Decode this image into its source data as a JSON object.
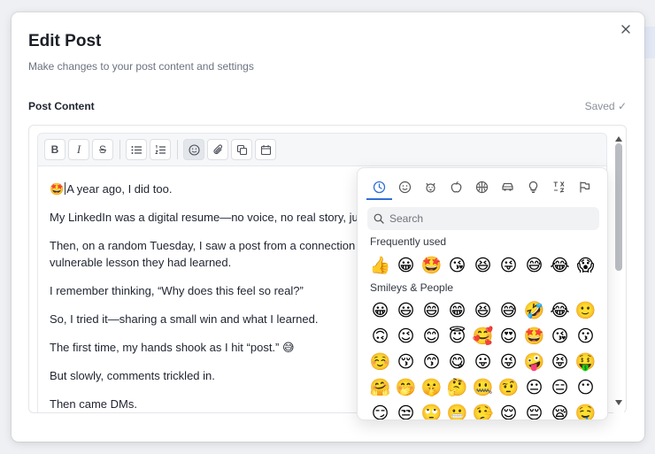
{
  "modal": {
    "title": "Edit Post",
    "subtitle": "Make changes to your post content and settings",
    "section_label": "Post Content",
    "saved_status": "Saved ✓",
    "close_icon": "close-icon"
  },
  "toolbar": {
    "bold": "B",
    "italic": "I",
    "strike": "S",
    "icons": [
      "bulleted-list-icon",
      "numbered-list-icon",
      "emoji-icon",
      "attach-icon",
      "copy-icon",
      "calendar-icon"
    ]
  },
  "editor": {
    "p1_emoji": "🤩",
    "p1_text": "A year ago, I did too.",
    "p2": "My LinkedIn was a digital resume—no voice, no real story, just",
    "p3a": "Then, on a random Tuesday, I saw a post from a connection wh",
    "p3b": "vulnerable lesson they had learned.",
    "p4": "I remember thinking, “Why does this feel so real?”",
    "p5": "So, I tried it—sharing a small win and what I learned.",
    "p6_text": "The first time, my hands shook as I hit “post.”",
    "p6_emoji": "😅",
    "p7": "But slowly, comments trickled in.",
    "p8": "Then came DMs."
  },
  "emoji_picker": {
    "categories": [
      "recent-icon",
      "smiley-icon",
      "animal-icon",
      "food-icon",
      "activity-icon",
      "travel-icon",
      "objects-icon",
      "symbols-icon",
      "flags-icon"
    ],
    "active_category": 0,
    "search_placeholder": "Search",
    "frequently_used_label": "Frequently used",
    "frequently_used": [
      "👍",
      "😀",
      "🤩",
      "😘",
      "😆",
      "😜",
      "😅",
      "😂",
      "😱"
    ],
    "smileys_label": "Smileys & People",
    "smileys_rows": [
      [
        "😀",
        "😃",
        "😄",
        "😁",
        "😆",
        "😅",
        "🤣",
        "😂",
        "🙂"
      ],
      [
        "🙃",
        "😉",
        "😊",
        "😇",
        "🥰",
        "😍",
        "🤩",
        "😘",
        "😗"
      ],
      [
        "☺️",
        "😚",
        "😙",
        "😋",
        "😛",
        "😜",
        "🤪",
        "😝",
        "🤑"
      ],
      [
        "🤗",
        "🤭",
        "🤫",
        "🤔",
        "🤐",
        "🤨",
        "😐",
        "😑",
        "😶"
      ],
      [
        "😏",
        "😒",
        "🙄",
        "😬",
        "🤥",
        "😌",
        "😔",
        "😪",
        "🤤"
      ]
    ]
  }
}
